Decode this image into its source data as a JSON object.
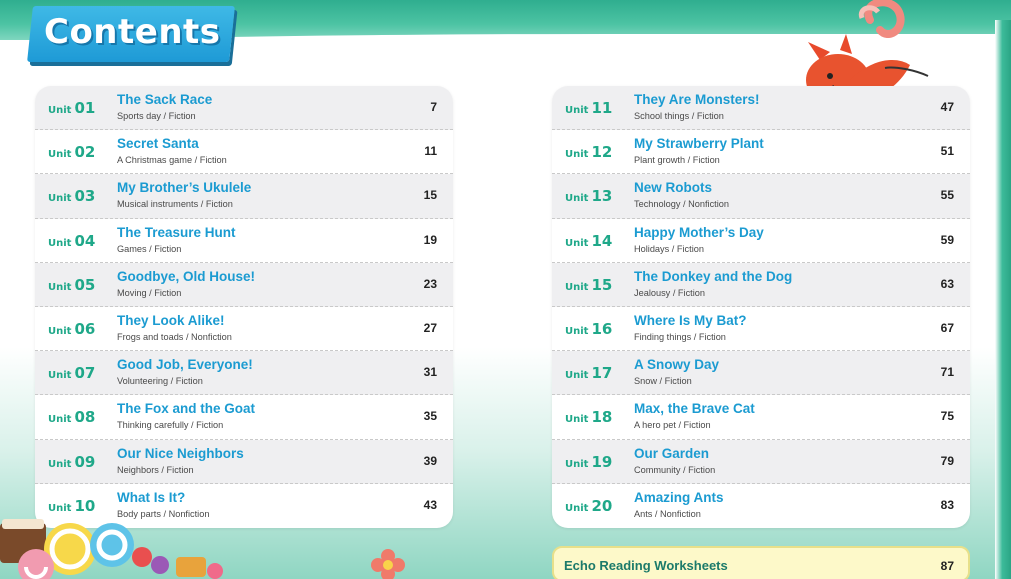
{
  "page": {
    "title": "Contents",
    "accent_color": "#1fa889",
    "title_color": "#1b9bd1",
    "badge_color": "#1e9ad6"
  },
  "units_left": [
    {
      "unit_prefix": "Unit",
      "unit_num": "01",
      "title": "The Sack Race",
      "subtitle": "Sports day / Fiction",
      "page": "7"
    },
    {
      "unit_prefix": "Unit",
      "unit_num": "02",
      "title": "Secret Santa",
      "subtitle": "A Christmas game / Fiction",
      "page": "11"
    },
    {
      "unit_prefix": "Unit",
      "unit_num": "03",
      "title": "My Brother’s Ukulele",
      "subtitle": "Musical instruments / Fiction",
      "page": "15"
    },
    {
      "unit_prefix": "Unit",
      "unit_num": "04",
      "title": "The Treasure Hunt",
      "subtitle": "Games / Fiction",
      "page": "19"
    },
    {
      "unit_prefix": "Unit",
      "unit_num": "05",
      "title": "Goodbye, Old House!",
      "subtitle": "Moving  / Fiction",
      "page": "23"
    },
    {
      "unit_prefix": "Unit",
      "unit_num": "06",
      "title": "They Look Alike!",
      "subtitle": "Frogs and toads / Nonfiction",
      "page": "27"
    },
    {
      "unit_prefix": "Unit",
      "unit_num": "07",
      "title": "Good Job, Everyone!",
      "subtitle": "Volunteering / Fiction",
      "page": "31"
    },
    {
      "unit_prefix": "Unit",
      "unit_num": "08",
      "title": "The Fox and the Goat",
      "subtitle": "Thinking carefully / Fiction",
      "page": "35"
    },
    {
      "unit_prefix": "Unit",
      "unit_num": "09",
      "title": "Our Nice Neighbors",
      "subtitle": "Neighbors / Fiction",
      "page": "39"
    },
    {
      "unit_prefix": "Unit",
      "unit_num": "10",
      "title": "What Is It?",
      "subtitle": "Body parts / Nonfiction",
      "page": "43"
    }
  ],
  "units_right": [
    {
      "unit_prefix": "Unit",
      "unit_num": "11",
      "title": "They Are Monsters!",
      "subtitle": "School things / Fiction",
      "page": "47"
    },
    {
      "unit_prefix": "Unit",
      "unit_num": "12",
      "title": "My Strawberry Plant",
      "subtitle": "Plant growth / Fiction",
      "page": "51"
    },
    {
      "unit_prefix": "Unit",
      "unit_num": "13",
      "title": "New Robots",
      "subtitle": "Technology / Nonfiction",
      "page": "55"
    },
    {
      "unit_prefix": "Unit",
      "unit_num": "14",
      "title": "Happy Mother’s Day",
      "subtitle": "Holidays / Fiction",
      "page": "59"
    },
    {
      "unit_prefix": "Unit",
      "unit_num": "15",
      "title": "The Donkey and the Dog",
      "subtitle": "Jealousy / Fiction",
      "page": "63"
    },
    {
      "unit_prefix": "Unit",
      "unit_num": "16",
      "title": "Where Is My Bat?",
      "subtitle": "Finding things / Fiction",
      "page": "67"
    },
    {
      "unit_prefix": "Unit",
      "unit_num": "17",
      "title": "A Snowy Day",
      "subtitle": "Snow / Fiction",
      "page": "71"
    },
    {
      "unit_prefix": "Unit",
      "unit_num": "18",
      "title": "Max, the Brave Cat",
      "subtitle": "A hero pet / Fiction",
      "page": "75"
    },
    {
      "unit_prefix": "Unit",
      "unit_num": "19",
      "title": "Our Garden",
      "subtitle": "Community / Fiction",
      "page": "79"
    },
    {
      "unit_prefix": "Unit",
      "unit_num": "20",
      "title": "Amazing Ants",
      "subtitle": "Ants / Nonfiction",
      "page": "83"
    }
  ],
  "worksheets": {
    "label": "Echo Reading Worksheets",
    "page": "87"
  },
  "illustrations": {
    "fox": "fox-illustration",
    "candy": "candy-illustration",
    "flower": "flower-illustration"
  }
}
